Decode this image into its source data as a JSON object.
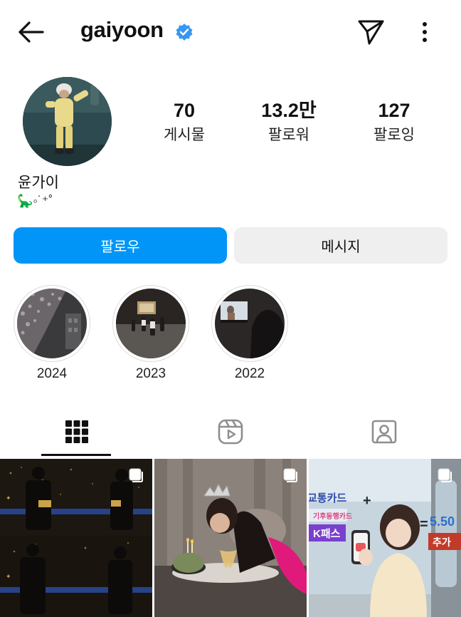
{
  "header": {
    "username": "gaiyoon",
    "verified": true,
    "icons": {
      "back": "back-arrow-icon",
      "send": "send-icon",
      "more": "more-vertical-icon",
      "verified": "verified-badge-icon"
    }
  },
  "profile": {
    "stats": [
      {
        "value": "70",
        "label": "게시물"
      },
      {
        "value": "13.2만",
        "label": "팔로워"
      },
      {
        "value": "127",
        "label": "팔로잉"
      }
    ],
    "full_name": "윤가이",
    "bio": "🦕◦˙⁺˚",
    "follow_label": "팔로우",
    "message_label": "메시지"
  },
  "highlights": [
    {
      "label": "2024"
    },
    {
      "label": "2023"
    },
    {
      "label": "2022"
    }
  ],
  "tabs": [
    {
      "icon": "grid-icon",
      "active": true
    },
    {
      "icon": "reels-icon",
      "active": false
    },
    {
      "icon": "tagged-icon",
      "active": false
    }
  ],
  "colors": {
    "accent": "#0095f6",
    "secondary_button": "#efefef",
    "verified": "#3897f0"
  },
  "posts": [
    {
      "multi": true
    },
    {
      "multi": true
    },
    {
      "multi": true,
      "texts": [
        "교통카드",
        "기후동행카드",
        "K패스",
        "5.50",
        "추가"
      ]
    }
  ]
}
